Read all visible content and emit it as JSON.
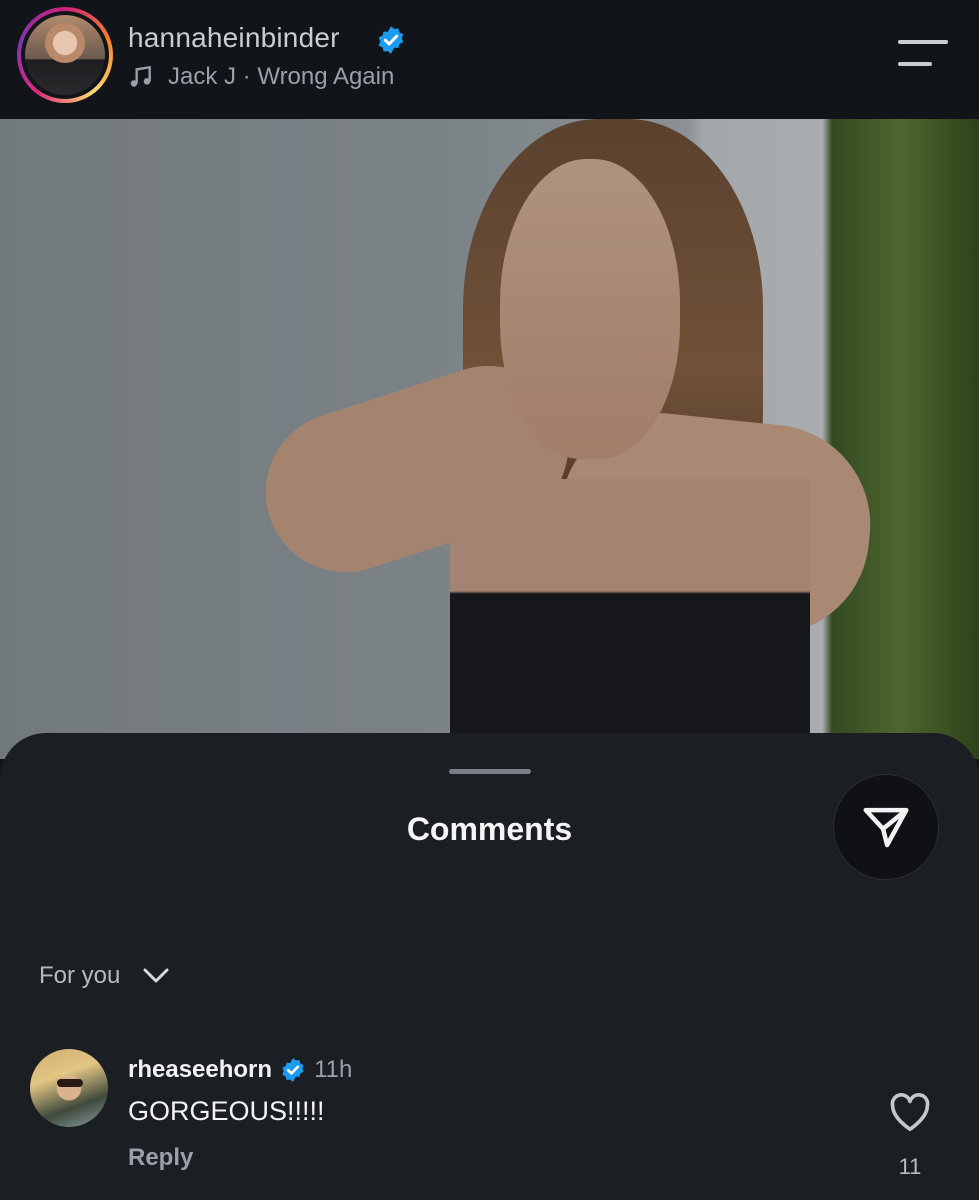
{
  "header": {
    "username": "hannaheinbinder",
    "verified_icon": "verified-badge-icon",
    "music": {
      "icon": "music-note-icon",
      "track": "Jack J · Wrong Again"
    },
    "menu_icon": "menu-icon"
  },
  "post": {
    "image": "photo-of-woman-in-black-top"
  },
  "comments_sheet": {
    "title": "Comments",
    "share_icon": "send-icon",
    "filter_label": "For you",
    "filter_icon": "chevron-down-icon",
    "items": [
      {
        "username": "rheaseehorn",
        "verified": true,
        "time": "11h",
        "text": "GORGEOUS!!!!!",
        "reply_label": "Reply",
        "like_icon": "heart-icon",
        "likes": "11"
      }
    ]
  },
  "colors": {
    "background": "#111418",
    "sheet": "#1b1e22",
    "verified_blue": "#1d9bf0",
    "muted_text": "#9aa0a8"
  }
}
